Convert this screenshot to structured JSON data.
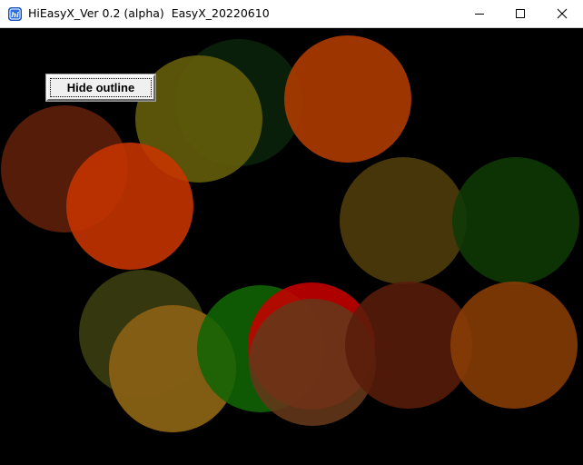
{
  "window": {
    "title": "HiEasyX_Ver 0.2 (alpha)  EasyX_20220610",
    "app_icon": "hieasyx-hi-icon",
    "controls": {
      "minimize_icon": "minimize-icon",
      "maximize_icon": "maximize-icon",
      "close_icon": "close-icon"
    }
  },
  "canvas": {
    "background": "#000000",
    "button": {
      "label": "Hide outline"
    },
    "circles": [
      {
        "color": "#0a230a"
      },
      {
        "color": "#b33c00"
      },
      {
        "color": "#65600a"
      },
      {
        "color": "#60200a"
      },
      {
        "color": "#c83400"
      },
      {
        "color": "#503e0a"
      },
      {
        "color": "#0f3a06"
      },
      {
        "color": "#3c4010"
      },
      {
        "color": "#cd4a0a"
      },
      {
        "color": "#7a6014"
      },
      {
        "color": "#116405"
      },
      {
        "color": "#c70000"
      },
      {
        "color": "#64381a"
      },
      {
        "color": "#5a1c0a"
      },
      {
        "color": "#8a3e06"
      }
    ]
  }
}
